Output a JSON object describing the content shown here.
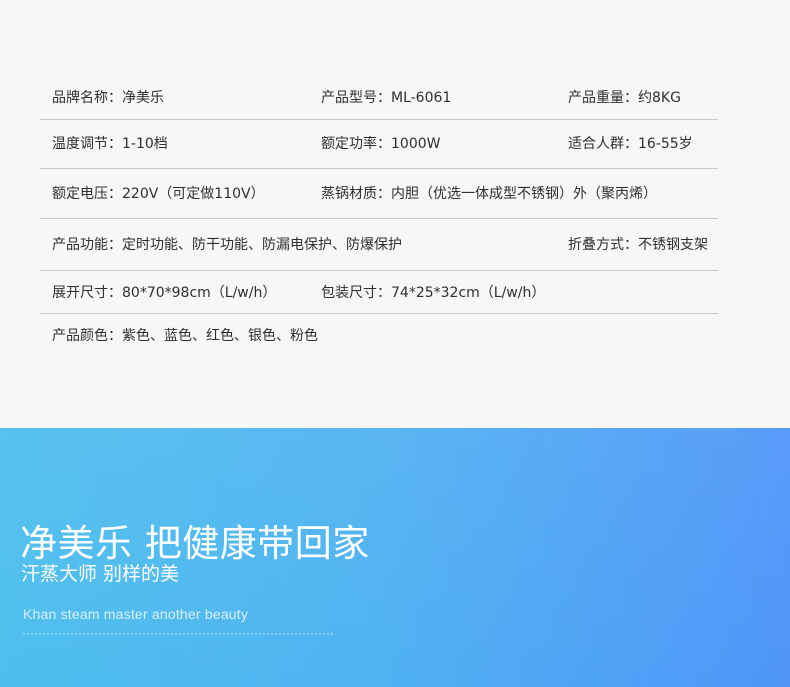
{
  "specs": {
    "brand": "品牌名称：净美乐",
    "model": "产品型号：ML-6061",
    "weight": "产品重量：约8KG",
    "temperature": "温度调节：1-10档",
    "power": "额定功率：1000W",
    "audience": "适合人群：16-55岁",
    "voltage": "额定电压：220V（可定做110V）",
    "material": "蒸锅材质：内胆（优选一体成型不锈钢）外（聚丙烯）",
    "functions": "产品功能：定时功能、防干功能、防漏电保护、防爆保护",
    "folding": "折叠方式：不锈钢支架",
    "unfolded_size": "展开尺寸：80*70*98cm（L/w/h）",
    "package_size": "包装尺寸：74*25*32cm（L/w/h）",
    "colors": "产品颜色：紫色、蓝色、红色、银色、粉色"
  },
  "banner": {
    "title": "净美乐 把健康带回家",
    "subtitle": "汗蒸大师 别样的美",
    "english": "Khan steam master another beauty",
    "gradient_start": "#4ebfed",
    "gradient_end": "#4f96f8"
  }
}
